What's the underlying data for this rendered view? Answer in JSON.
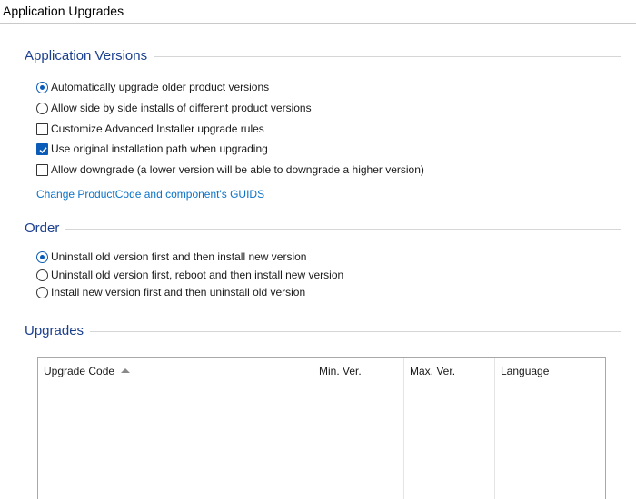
{
  "window": {
    "title": "Application Upgrades"
  },
  "sections": {
    "versions": {
      "title": "Application Versions"
    },
    "order": {
      "title": "Order"
    },
    "upgrades": {
      "title": "Upgrades"
    }
  },
  "versions_options": [
    {
      "type": "radio",
      "label": "Automatically upgrade older product versions",
      "checked": true
    },
    {
      "type": "radio",
      "label": "Allow side by side installs of different product versions",
      "checked": false
    },
    {
      "type": "checkbox",
      "label": "Customize Advanced Installer upgrade rules",
      "checked": false
    },
    {
      "type": "checkbox",
      "label": "Use original installation path when upgrading",
      "checked": true
    },
    {
      "type": "checkbox",
      "label": "Allow downgrade (a lower version will be able to downgrade a higher version)",
      "checked": false
    }
  ],
  "guid_link": {
    "label": "Change ProductCode and component's GUIDS"
  },
  "order_options": [
    {
      "type": "radio",
      "label": "Uninstall old version first and then install new version",
      "checked": true
    },
    {
      "type": "radio",
      "label": "Uninstall old version first, reboot and then install new version",
      "checked": false
    },
    {
      "type": "radio",
      "label": "Install new version first and then uninstall old version",
      "checked": false
    }
  ],
  "upgrades_table": {
    "columns": [
      "Upgrade Code",
      "Min. Ver.",
      "Max. Ver.",
      "Language"
    ],
    "sorted_column": "Upgrade Code",
    "sort_direction": "ascending",
    "rows": []
  },
  "colors": {
    "accent": "#0b5cb8",
    "section_title": "#1b3f8f",
    "link": "#0a73c9"
  }
}
